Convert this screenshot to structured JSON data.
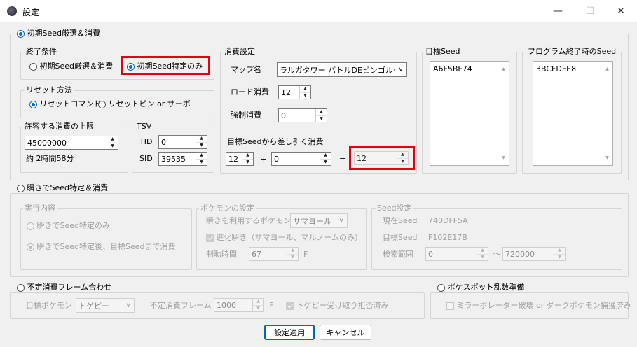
{
  "window": {
    "title": "設定",
    "min_icon": "minimize-icon",
    "max_icon": "maximize-icon",
    "close_icon": "close-icon"
  },
  "sec1": {
    "title": "初期Seed厳選＆消費",
    "end": {
      "title": "終了条件",
      "opt1": "初期Seed厳選＆消費",
      "opt2": "初期Seed特定のみ"
    },
    "reset": {
      "title": "リセット方法",
      "opt1": "リセットコマンド",
      "opt2": "リセットピン or サーボ"
    },
    "limit": {
      "title": "許容する消費の上限",
      "value": "45000000",
      "approx": "約 2時間58分"
    },
    "tsv": {
      "title": "TSV",
      "tid_label": "TID",
      "tid": "0",
      "sid_label": "SID",
      "sid": "39535"
    },
    "cons": {
      "title": "消費設定",
      "map_label": "マップ名",
      "map": "ラルガタワー バトルDEビンゴルーム",
      "load_label": "ロード消費",
      "load": "12",
      "force_label": "強制消費",
      "force": "0",
      "sub_label": "目標Seedから差し引く消費",
      "a": "12",
      "plus": "+",
      "b": "0",
      "eq": "=",
      "result": "12"
    },
    "target": {
      "title": "目標Seed",
      "value": "A6F5BF74"
    },
    "end_seed": {
      "title": "プログラム終了時のSeed",
      "value": "3BCFDFE8"
    }
  },
  "sec2": {
    "title": "瞬きでSeed特定＆消費",
    "exec": {
      "title": "実行内容",
      "opt1": "瞬きでSeed特定のみ",
      "opt2": "瞬きでSeed特定後、目標Seedまで消費"
    },
    "pkmn": {
      "title": "ポケモンの設定",
      "use_label": "瞬きを利用するポケモン",
      "use": "サマヨール",
      "evo": "進化瞬き（サマヨール、マルノームのみ）",
      "time_label": "制動時間",
      "time": "67",
      "unit": "F"
    },
    "seed": {
      "title": "Seed設定",
      "cur_label": "現在Seed",
      "cur": "740DFF5A",
      "tgt_label": "目標Seed",
      "tgt": "F102E17B",
      "range_label": "検索範囲",
      "from": "0",
      "tilde": "～",
      "to": "720000"
    }
  },
  "sec3": {
    "title": "不定消費フレーム合わせ",
    "pk_label": "目標ポケモン",
    "pk": "トゲピー",
    "frame_label": "不定消費フレーム",
    "frame": "1000",
    "unit": "F",
    "check": "トゲピー受け取り拒否済み"
  },
  "sec4": {
    "title": "ポケスポット乱数準備",
    "check": "ミラーボレーダー破壊 or ダークポケモン捕獲済み"
  },
  "buttons": {
    "apply": "設定適用",
    "cancel": "キャンセル"
  }
}
